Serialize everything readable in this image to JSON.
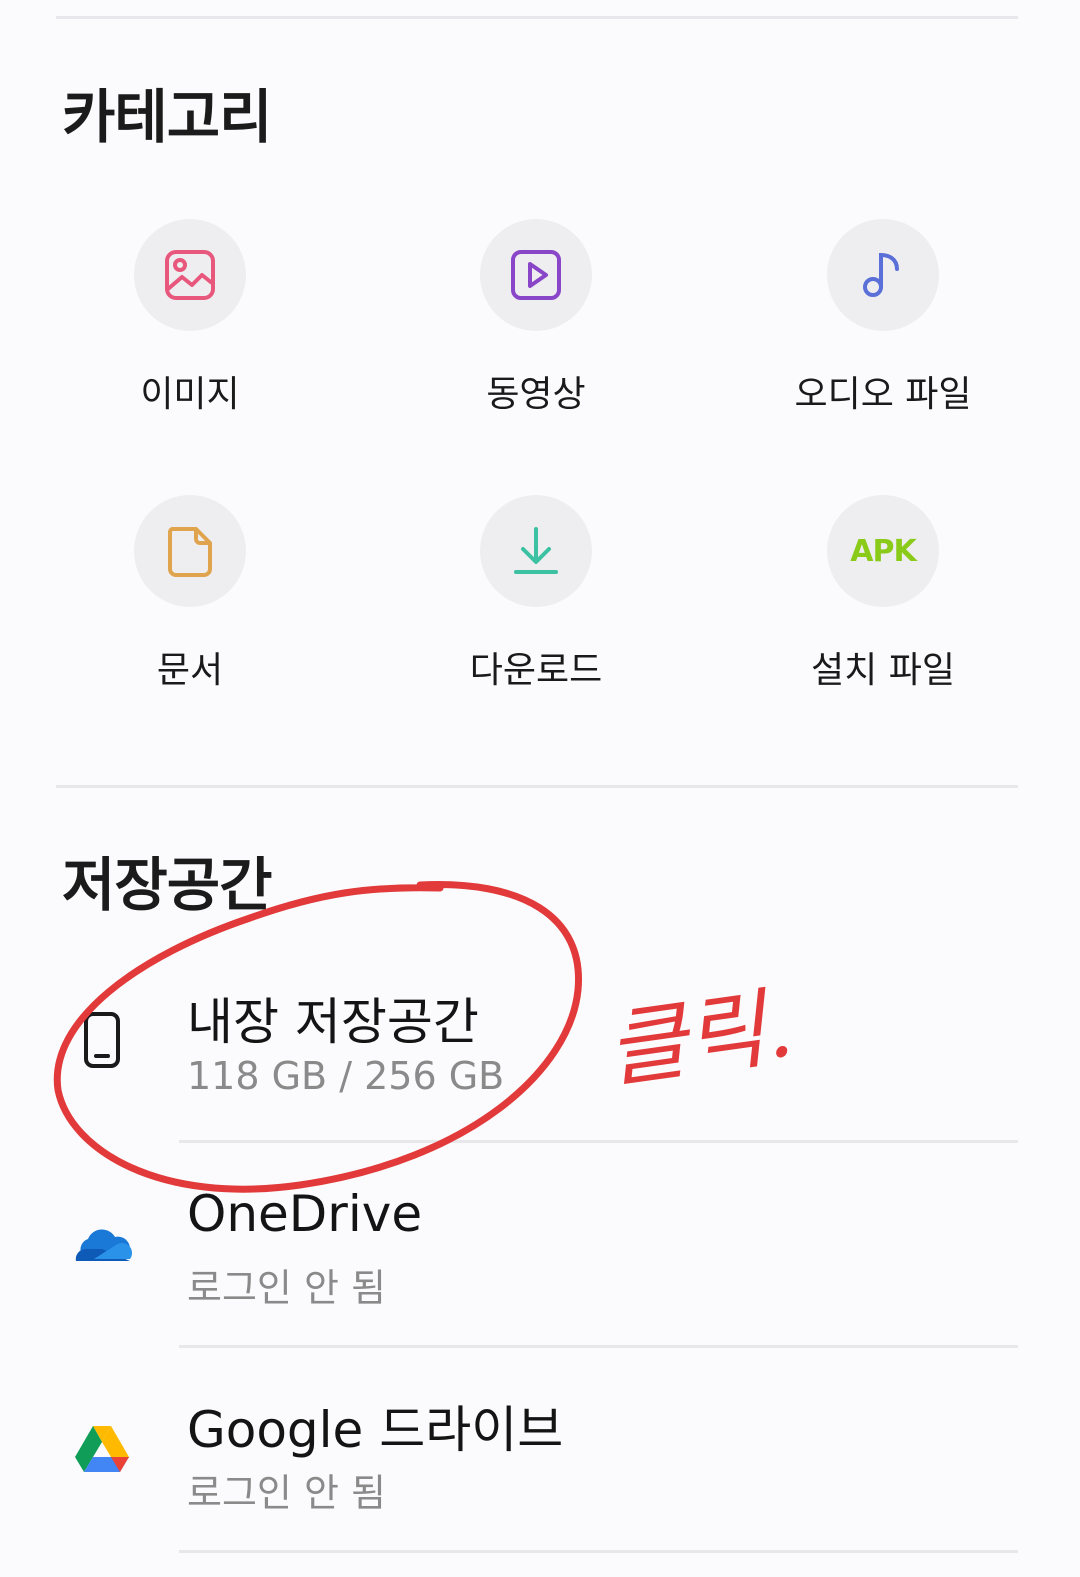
{
  "categories_section": {
    "title": "카테고리",
    "items": [
      {
        "label": "이미지",
        "icon": "image-icon",
        "color": "#e8587d"
      },
      {
        "label": "동영상",
        "icon": "video-icon",
        "color": "#8a46c8"
      },
      {
        "label": "오디오 파일",
        "icon": "music-note-icon",
        "color": "#5b6fd8"
      },
      {
        "label": "문서",
        "icon": "document-icon",
        "color": "#e0a44e"
      },
      {
        "label": "다운로드",
        "icon": "download-icon",
        "color": "#3cc1a3"
      },
      {
        "label": "설치 파일",
        "icon": "apk-icon",
        "icon_text": "APK",
        "color": "#8acb1a"
      }
    ]
  },
  "storage_section": {
    "title": "저장공간",
    "items": [
      {
        "title": "내장 저장공간",
        "subtitle": "118 GB / 256 GB",
        "icon": "phone-icon"
      },
      {
        "title": "OneDrive",
        "subtitle": "로그인 안 됨",
        "icon": "onedrive-icon"
      },
      {
        "title": "Google 드라이브",
        "subtitle": "로그인 안 됨",
        "icon": "google-drive-icon"
      }
    ]
  },
  "annotation": {
    "handwritten_text": "클릭.",
    "color": "#e23a3a"
  }
}
